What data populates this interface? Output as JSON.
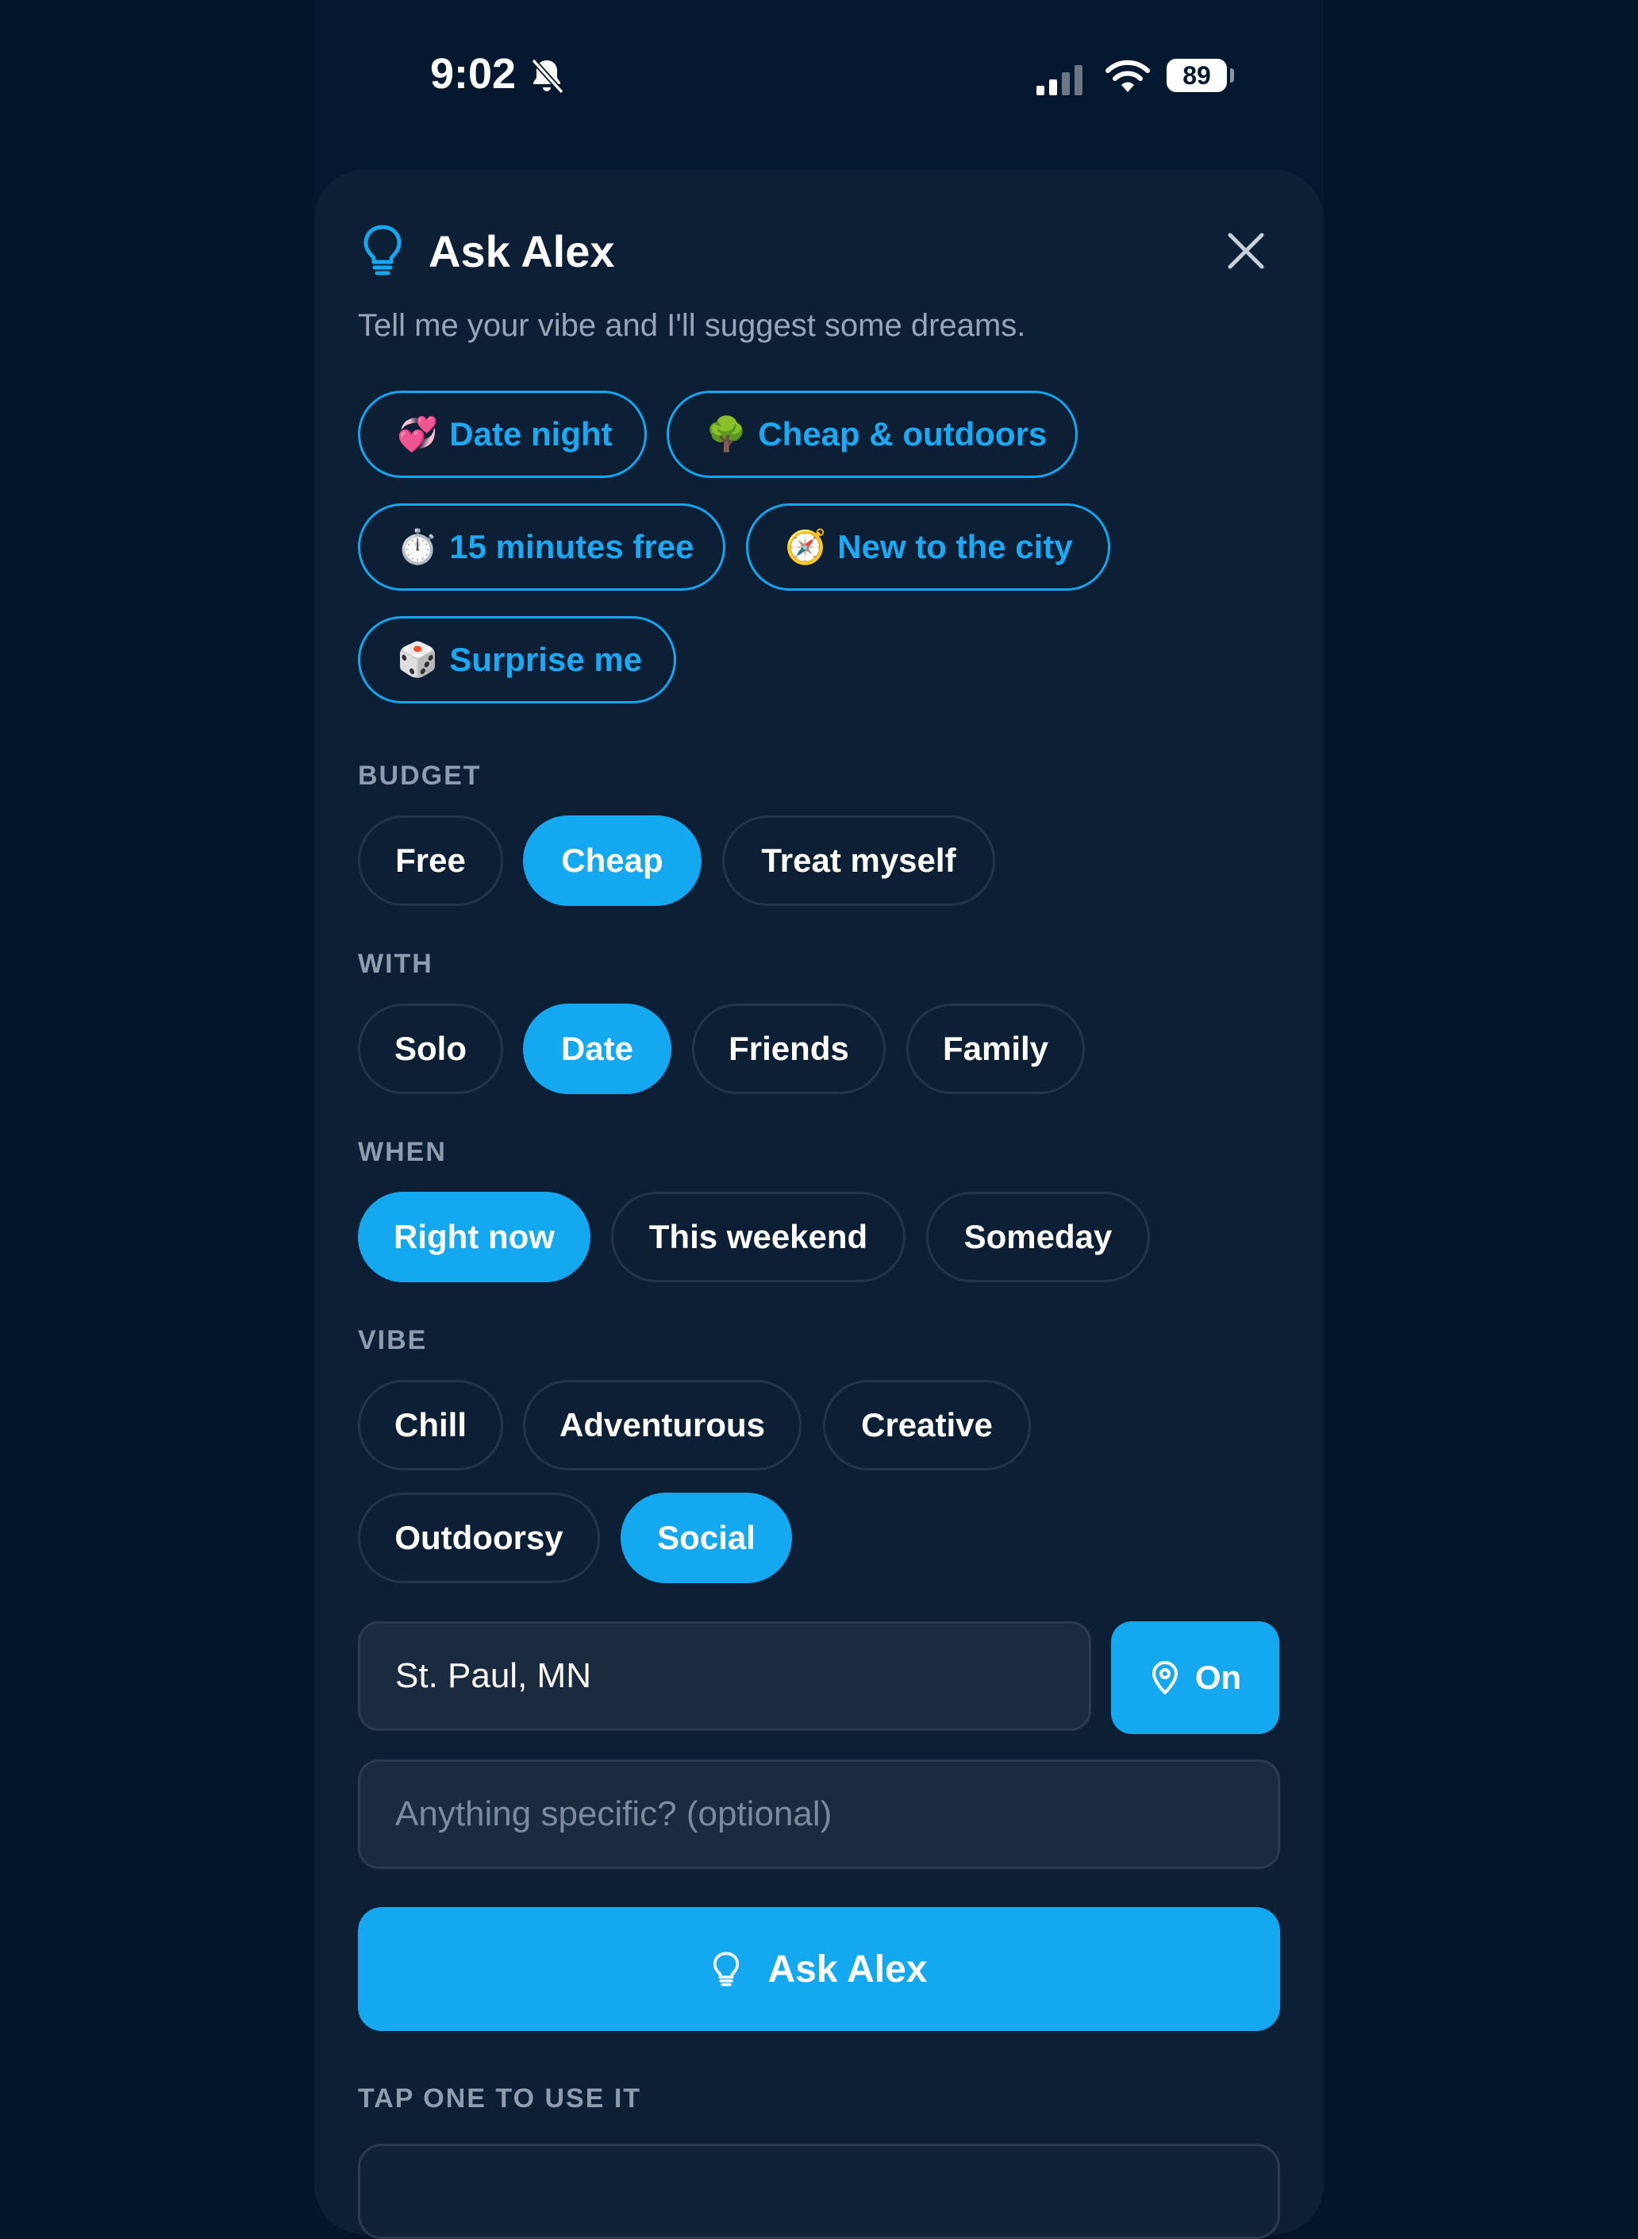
{
  "status_bar": {
    "time": "9:02",
    "battery": "89"
  },
  "header": {
    "title": "Ask Alex",
    "subtitle": "Tell me your vibe and I'll suggest some dreams."
  },
  "suggestions": [
    {
      "emoji": "💞",
      "label": "Date night"
    },
    {
      "emoji": "🌳",
      "label": "Cheap & outdoors"
    },
    {
      "emoji": "⏱️",
      "label": "15 minutes free"
    },
    {
      "emoji": "🧭",
      "label": "New to the city"
    },
    {
      "emoji": "🎲",
      "label": "Surprise me"
    }
  ],
  "budget": {
    "label": "BUDGET",
    "options": [
      "Free",
      "Cheap",
      "Treat myself"
    ],
    "selected": "Cheap"
  },
  "with": {
    "label": "WITH",
    "options": [
      "Solo",
      "Date",
      "Friends",
      "Family"
    ],
    "selected": "Date"
  },
  "when": {
    "label": "WHEN",
    "options": [
      "Right now",
      "This weekend",
      "Someday"
    ],
    "selected": "Right now"
  },
  "vibe": {
    "label": "VIBE",
    "options": [
      "Chill",
      "Adventurous",
      "Creative",
      "Outdoorsy",
      "Social"
    ],
    "selected": "Social"
  },
  "location": {
    "value": "St. Paul, MN",
    "toggle_label": "On"
  },
  "specific": {
    "placeholder": "Anything specific? (optional)"
  },
  "submit": {
    "label": "Ask Alex"
  },
  "results": {
    "label": "TAP ONE TO USE IT"
  },
  "colors": {
    "accent": "#13a8f0",
    "background": "#04192f",
    "card": "#0c1f34"
  }
}
